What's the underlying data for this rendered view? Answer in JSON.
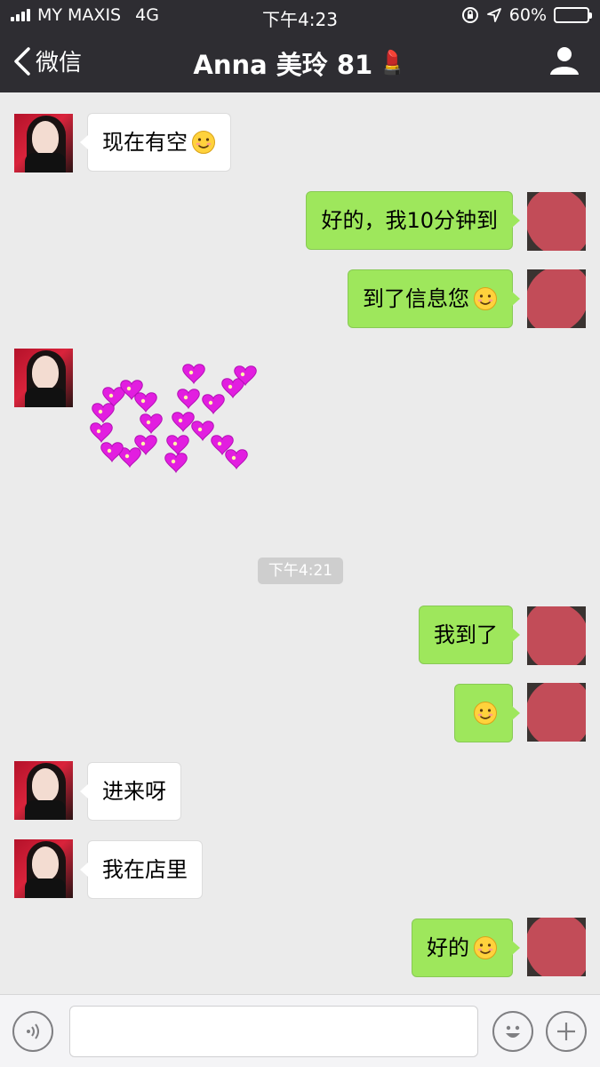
{
  "status_bar": {
    "carrier": "MY MAXIS",
    "network": "4G",
    "time": "下午4:23",
    "battery_percent": "60%",
    "battery_level": 0.6
  },
  "nav": {
    "back_label": "微信",
    "title": "Anna 美玲 81",
    "title_emoji": "💄",
    "profile_icon": "person-icon"
  },
  "messages": [
    {
      "sender": "her",
      "text": "现在有空",
      "emoji": "smile"
    },
    {
      "sender": "me",
      "text": "好的，我10分钟到"
    },
    {
      "sender": "me",
      "text": "到了信息您",
      "emoji": "smile"
    },
    {
      "sender": "her",
      "sticker": "OK",
      "sticker_color": "#e21ee0"
    },
    {
      "timestamp": "下午4:21"
    },
    {
      "sender": "me",
      "text": "我到了"
    },
    {
      "sender": "me",
      "text": "",
      "emoji": "smile"
    },
    {
      "sender": "her",
      "text": "进来呀"
    },
    {
      "sender": "her",
      "text": "我在店里"
    },
    {
      "sender": "me",
      "text": "好的",
      "emoji": "smile"
    }
  ],
  "input_bar": {
    "voice_icon": "voice-icon",
    "emoji_icon": "emoji-icon",
    "plus_icon": "plus-icon",
    "text_value": ""
  },
  "colors": {
    "header_bg": "#2e2d32",
    "chat_bg": "#ebebeb",
    "out_bubble": "#9ee75c",
    "in_bubble": "#ffffff",
    "sticker_pink": "#e21ee0",
    "redaction": "#c84d5a"
  }
}
